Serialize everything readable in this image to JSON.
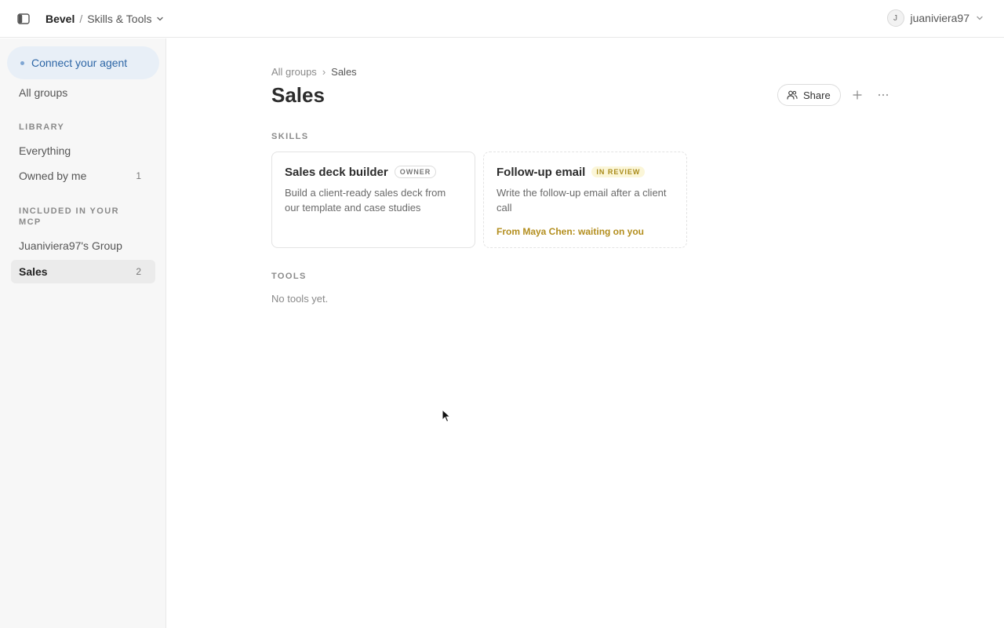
{
  "header": {
    "app_name": "Bevel",
    "separator": "/",
    "section": "Skills & Tools",
    "user": {
      "initial": "J",
      "name": "juaniviera97"
    }
  },
  "sidebar": {
    "connect_label": "Connect your agent",
    "all_groups": "All groups",
    "library_heading": "LIBRARY",
    "library_items": [
      {
        "label": "Everything",
        "count": ""
      },
      {
        "label": "Owned by me",
        "count": "1"
      }
    ],
    "mcp_heading": "INCLUDED IN YOUR MCP",
    "mcp_items": [
      {
        "label": "Juaniviera97's Group",
        "count": ""
      },
      {
        "label": "Sales",
        "count": "2",
        "active": true
      }
    ]
  },
  "main": {
    "breadcrumb": {
      "parent": "All groups",
      "separator": "›",
      "current": "Sales"
    },
    "title": "Sales",
    "share_label": "Share",
    "skills_label": "SKILLS",
    "skills": [
      {
        "title": "Sales deck builder",
        "badge": "OWNER",
        "description": "Build a client-ready sales deck from our template and case studies"
      },
      {
        "title": "Follow-up email",
        "badge": "IN REVIEW",
        "description": "Write the follow-up email after a client call",
        "note": "From Maya Chen: waiting on you"
      }
    ],
    "tools_label": "TOOLS",
    "tools_empty": "No tools yet."
  },
  "colors": {
    "accent_blue": "#2d66a6",
    "connect_bg": "#e8eff7",
    "review_text": "#b38e1e",
    "review_bg": "#fbf6d8",
    "sidebar_bg": "#f7f7f7",
    "active_item_bg": "#ebebeb"
  },
  "icons": {
    "sidebar_toggle": "sidebar-panel-icon",
    "section_caret": "chevron-down-icon",
    "user_caret": "chevron-down-icon",
    "share": "users-icon",
    "add": "plus-icon",
    "more": "more-horizontal-icon",
    "pointer": "mouse-cursor-icon"
  }
}
